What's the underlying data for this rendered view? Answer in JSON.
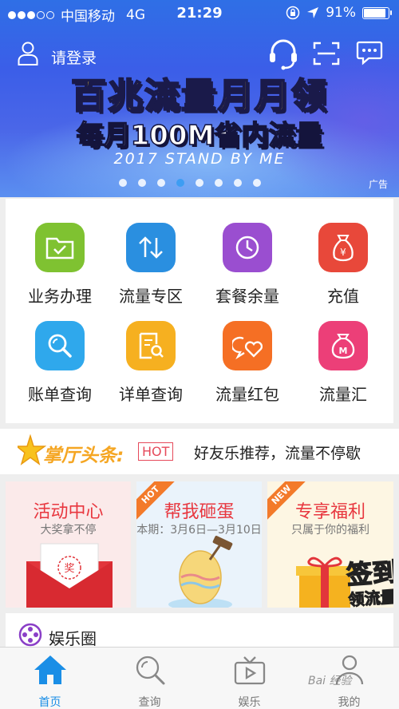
{
  "status_bar": {
    "carrier": "中国移动",
    "network": "4G",
    "time": "21:29",
    "battery_percent": "91%",
    "battery_level": 0.91
  },
  "header": {
    "login_label": "请登录"
  },
  "banner": {
    "headline": "百兆流量月月领",
    "subheadline": "每月100M省内流量",
    "tagline": "2017 STAND BY ME",
    "ad_label": "广告",
    "slide_count": 8,
    "active_slide": 3
  },
  "services": [
    {
      "label": "业务办理",
      "icon": "folder-check-icon",
      "color": "#7fc231"
    },
    {
      "label": "流量专区",
      "icon": "updown-arrows-icon",
      "color": "#2a8fe0"
    },
    {
      "label": "套餐余量",
      "icon": "clock-pie-icon",
      "color": "#9a4ed0"
    },
    {
      "label": "充值",
      "icon": "money-bag-icon",
      "color": "#e8483a"
    },
    {
      "label": "账单查询",
      "icon": "search-bill-icon",
      "color": "#2fa8ec"
    },
    {
      "label": "详单查询",
      "icon": "document-search-icon",
      "color": "#f6b020"
    },
    {
      "label": "流量红包",
      "icon": "heart-chat-icon",
      "color": "#f56f24"
    },
    {
      "label": "流量汇",
      "icon": "m-bag-icon",
      "color": "#ec3f78"
    }
  ],
  "news": {
    "title": "掌厅头条:",
    "badge": "HOT",
    "text": "好友乐推荐，流量不停歇"
  },
  "promos": [
    {
      "title": "活动中心",
      "subtitle": "大奖拿不停",
      "ribbon": ""
    },
    {
      "title": "帮我砸蛋",
      "subtitle": "本期：3月6日—3月10日",
      "ribbon": "HOT"
    },
    {
      "title": "专享福利",
      "subtitle": "只属于你的福利",
      "ribbon": "NEW",
      "overlay_line1": "签到",
      "overlay_line2": "领流量"
    }
  ],
  "entertainment": {
    "label": "娱乐圈"
  },
  "tabs": [
    {
      "label": "首页",
      "active": true
    },
    {
      "label": "查询",
      "active": false
    },
    {
      "label": "娱乐",
      "active": false
    },
    {
      "label": "我的",
      "active": false
    }
  ],
  "watermark": "Bai 经验",
  "colors": {
    "accent_blue": "#1a8ee6",
    "banner_blue": "#3b5ee8",
    "headline_yellow": "#ffd83a",
    "hot_red": "#e64a5b",
    "news_orange": "#f5a623"
  }
}
